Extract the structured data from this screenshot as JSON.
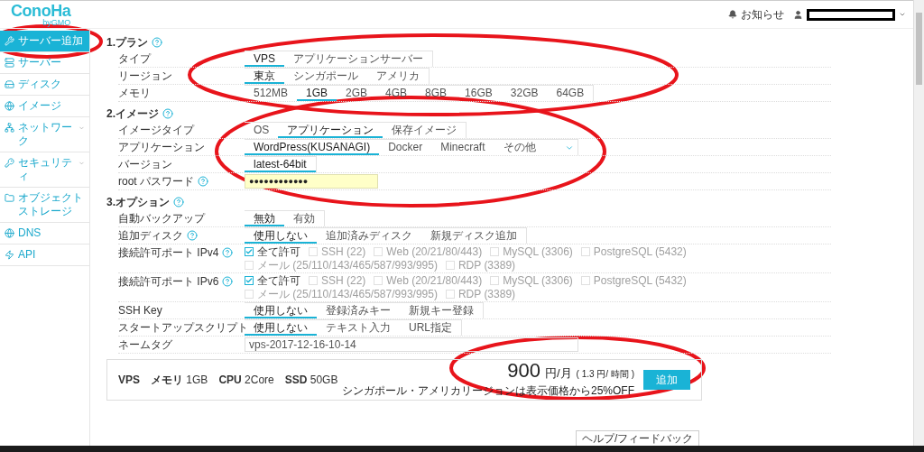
{
  "header": {
    "logo": "ConoHa",
    "logo_sub": "byGMO",
    "notice": "お知らせ"
  },
  "sidebar": {
    "items": [
      {
        "label": "サーバー追加",
        "selected": true,
        "submenu": false
      },
      {
        "label": "サーバー",
        "selected": false,
        "submenu": false
      },
      {
        "label": "ディスク",
        "selected": false,
        "submenu": false
      },
      {
        "label": "イメージ",
        "selected": false,
        "submenu": false
      },
      {
        "label": "ネットワーク",
        "selected": false,
        "submenu": true
      },
      {
        "label": "セキュリティ",
        "selected": false,
        "submenu": true
      },
      {
        "label": "オブジェクトストレージ",
        "selected": false,
        "submenu": false
      },
      {
        "label": "DNS",
        "selected": false,
        "submenu": false
      },
      {
        "label": "API",
        "selected": false,
        "submenu": false
      }
    ]
  },
  "sections": [
    {
      "title": "1.プラン",
      "help": true,
      "rows": [
        {
          "kind": "tabs",
          "label": "タイプ",
          "help": false,
          "dropdown": false,
          "options": [
            {
              "label": "VPS",
              "selected": true
            },
            {
              "label": "アプリケーションサーバー",
              "selected": false
            }
          ]
        },
        {
          "kind": "tabs",
          "label": "リージョン",
          "help": false,
          "dropdown": false,
          "options": [
            {
              "label": "東京",
              "selected": true
            },
            {
              "label": "シンガポール",
              "selected": false
            },
            {
              "label": "アメリカ",
              "selected": false
            }
          ]
        },
        {
          "kind": "tabs",
          "label": "メモリ",
          "help": false,
          "dropdown": false,
          "options": [
            {
              "label": "512MB",
              "selected": false
            },
            {
              "label": "1GB",
              "selected": true
            },
            {
              "label": "2GB",
              "selected": false
            },
            {
              "label": "4GB",
              "selected": false
            },
            {
              "label": "8GB",
              "selected": false
            },
            {
              "label": "16GB",
              "selected": false
            },
            {
              "label": "32GB",
              "selected": false
            },
            {
              "label": "64GB",
              "selected": false
            }
          ]
        }
      ]
    },
    {
      "title": "2.イメージ",
      "help": true,
      "rows": [
        {
          "kind": "tabs",
          "label": "イメージタイプ",
          "help": false,
          "dropdown": false,
          "options": [
            {
              "label": "OS",
              "selected": false
            },
            {
              "label": "アプリケーション",
              "selected": true
            },
            {
              "label": "保存イメージ",
              "selected": false
            }
          ]
        },
        {
          "kind": "tabs",
          "label": "アプリケーション",
          "help": false,
          "dropdown": true,
          "options": [
            {
              "label": "WordPress(KUSANAGI)",
              "selected": true
            },
            {
              "label": "Docker",
              "selected": false
            },
            {
              "label": "Minecraft",
              "selected": false
            },
            {
              "label": "その他",
              "selected": false
            }
          ]
        },
        {
          "kind": "tabs",
          "label": "バージョン",
          "help": false,
          "dropdown": false,
          "options": [
            {
              "label": "latest-64bit",
              "selected": true
            }
          ]
        },
        {
          "kind": "password",
          "label": "root パスワード",
          "help": true,
          "value": "●●●●●●●●●●●●"
        }
      ]
    },
    {
      "title": "3.オプション",
      "help": true,
      "rows": [
        {
          "kind": "tabs",
          "label": "自動バックアップ",
          "help": false,
          "dropdown": false,
          "options": [
            {
              "label": "無効",
              "selected": true
            },
            {
              "label": "有効",
              "selected": false
            }
          ]
        },
        {
          "kind": "tabs",
          "label": "追加ディスク",
          "help": true,
          "dropdown": false,
          "options": [
            {
              "label": "使用しない",
              "selected": true
            },
            {
              "label": "追加済みディスク",
              "selected": false
            },
            {
              "label": "新規ディスク追加",
              "selected": false
            }
          ]
        },
        {
          "kind": "ports",
          "label": "接続許可ポート IPv4",
          "help": true,
          "options": [
            {
              "label": "全て許可",
              "checked": true,
              "disabled": false
            },
            {
              "label": "SSH (22)",
              "checked": false,
              "disabled": true
            },
            {
              "label": "Web (20/21/80/443)",
              "checked": false,
              "disabled": true
            },
            {
              "label": "MySQL (3306)",
              "checked": false,
              "disabled": true
            },
            {
              "label": "PostgreSQL (5432)",
              "checked": false,
              "disabled": true
            },
            {
              "label": "メール (25/110/143/465/587/993/995)",
              "checked": false,
              "disabled": true
            },
            {
              "label": "RDP (3389)",
              "checked": false,
              "disabled": true
            }
          ]
        },
        {
          "kind": "ports",
          "label": "接続許可ポート IPv6",
          "help": true,
          "options": [
            {
              "label": "全て許可",
              "checked": true,
              "disabled": false
            },
            {
              "label": "SSH (22)",
              "checked": false,
              "disabled": true
            },
            {
              "label": "Web (20/21/80/443)",
              "checked": false,
              "disabled": true
            },
            {
              "label": "MySQL (3306)",
              "checked": false,
              "disabled": true
            },
            {
              "label": "PostgreSQL (5432)",
              "checked": false,
              "disabled": true
            },
            {
              "label": "メール (25/110/143/465/587/993/995)",
              "checked": false,
              "disabled": true
            },
            {
              "label": "RDP (3389)",
              "checked": false,
              "disabled": true
            }
          ]
        },
        {
          "kind": "tabs",
          "label": "SSH Key",
          "help": false,
          "dropdown": false,
          "options": [
            {
              "label": "使用しない",
              "selected": true
            },
            {
              "label": "登録済みキー",
              "selected": false
            },
            {
              "label": "新規キー登録",
              "selected": false
            }
          ]
        },
        {
          "kind": "tabs",
          "label": "スタートアップスクリプト",
          "help": false,
          "dropdown": false,
          "options": [
            {
              "label": "使用しない",
              "selected": true
            },
            {
              "label": "テキスト入力",
              "selected": false
            },
            {
              "label": "URL指定",
              "selected": false
            }
          ]
        },
        {
          "kind": "text",
          "label": "ネームタグ",
          "help": false,
          "value": "vps-2017-12-16-10-14"
        }
      ]
    }
  ],
  "summary": {
    "specs": "**VPS**　**メモリ** 1GB　**CPU** 2Core　**SSD** 50GB",
    "price": "900",
    "unit": "円/月",
    "hourly": "( 1.3 円/ 時間 )",
    "note": "シンガポール・アメリカリージョンは表示価格から25%OFF",
    "button": "追加"
  },
  "help_tab": "ヘルプ/フィードバック"
}
